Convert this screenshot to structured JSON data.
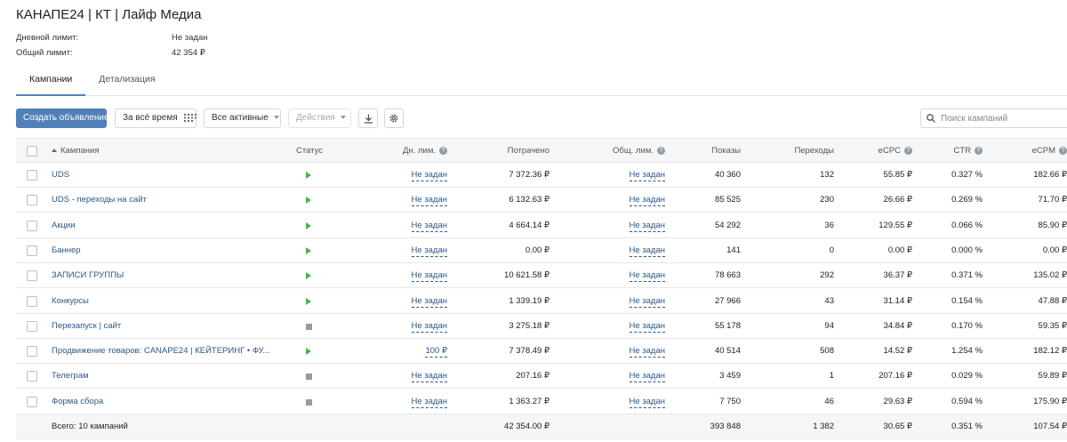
{
  "header": {
    "title": "КАНАПЕ24 | КТ | Лайф Медиа",
    "daily_limit_label": "Дневной лимит:",
    "daily_limit_value": "Не задан",
    "total_limit_label": "Общий лимит:",
    "total_limit_value": "42 354 ₽"
  },
  "tabs": [
    {
      "label": "Кампании",
      "active": true
    },
    {
      "label": "Детализация",
      "active": false
    }
  ],
  "toolbar": {
    "create_label": "Создать объявление",
    "period_label": "За всё время",
    "filter_label": "Все активные",
    "actions_label": "Действия",
    "search_placeholder": "Поиск кампаний",
    "download_icon": "download-icon",
    "settings_icon": "gear-icon"
  },
  "columns": {
    "campaign": "Кампания",
    "status": "Статус",
    "daily": "Дн. лим.",
    "spent": "Потрачено",
    "total": "Общ. лим.",
    "impressions": "Показы",
    "clicks": "Переходы",
    "ecpc": "eCPC",
    "ctr": "CTR",
    "ecpm": "eCPM"
  },
  "rows": [
    {
      "name": "UDS",
      "status": "play",
      "daily": "Не задан",
      "spent": "7 372.36 ₽",
      "total": "Не задан",
      "impressions": "40 360",
      "clicks": "132",
      "ecpc": "55.85 ₽",
      "ctr": "0.327 %",
      "ecpm": "182.66 ₽"
    },
    {
      "name": "UDS - переходы на сайт",
      "status": "play",
      "daily": "Не задан",
      "spent": "6 132.63 ₽",
      "total": "Не задан",
      "impressions": "85 525",
      "clicks": "230",
      "ecpc": "26.66 ₽",
      "ctr": "0.269 %",
      "ecpm": "71.70 ₽"
    },
    {
      "name": "Акции",
      "status": "play",
      "daily": "Не задан",
      "spent": "4 664.14 ₽",
      "total": "Не задан",
      "impressions": "54 292",
      "clicks": "36",
      "ecpc": "129.55 ₽",
      "ctr": "0.066 %",
      "ecpm": "85.90 ₽"
    },
    {
      "name": "Баннер",
      "status": "play",
      "daily": "Не задан",
      "spent": "0.00 ₽",
      "total": "Не задан",
      "impressions": "141",
      "clicks": "0",
      "ecpc": "0.00 ₽",
      "ctr": "0.000 %",
      "ecpm": "0.00 ₽"
    },
    {
      "name": "ЗАПИСИ ГРУППЫ",
      "status": "play",
      "daily": "Не задан",
      "spent": "10 621.58 ₽",
      "total": "Не задан",
      "impressions": "78 663",
      "clicks": "292",
      "ecpc": "36.37 ₽",
      "ctr": "0.371 %",
      "ecpm": "135.02 ₽"
    },
    {
      "name": "Конкурсы",
      "status": "play",
      "daily": "Не задан",
      "spent": "1 339.19 ₽",
      "total": "Не задан",
      "impressions": "27 966",
      "clicks": "43",
      "ecpc": "31.14 ₽",
      "ctr": "0.154 %",
      "ecpm": "47.88 ₽"
    },
    {
      "name": "Перезапуск | сайт",
      "status": "stop",
      "daily": "Не задан",
      "spent": "3 275.18 ₽",
      "total": "Не задан",
      "impressions": "55 178",
      "clicks": "94",
      "ecpc": "34.84 ₽",
      "ctr": "0.170 %",
      "ecpm": "59.35 ₽"
    },
    {
      "name": "Продвижение товаров: CANAPE24 | КЕЙТЕРИНГ • ФУ...",
      "status": "play",
      "daily": "100 ₽",
      "spent": "7 378.49 ₽",
      "total": "Не задан",
      "impressions": "40 514",
      "clicks": "508",
      "ecpc": "14.52 ₽",
      "ctr": "1.254 %",
      "ecpm": "182.12 ₽"
    },
    {
      "name": "Телеграм",
      "status": "stop",
      "daily": "Не задан",
      "spent": "207.16 ₽",
      "total": "Не задан",
      "impressions": "3 459",
      "clicks": "1",
      "ecpc": "207.16 ₽",
      "ctr": "0.029 %",
      "ecpm": "59.89 ₽"
    },
    {
      "name": "Форма сбора",
      "status": "stop",
      "daily": "Не задан",
      "spent": "1 363.27 ₽",
      "total": "Не задан",
      "impressions": "7 750",
      "clicks": "46",
      "ecpc": "29.63 ₽",
      "ctr": "0.594 %",
      "ecpm": "175.90 ₽"
    }
  ],
  "footer": {
    "label": "Всего: 10 кампаний",
    "spent": "42 354.00 ₽",
    "impressions": "393 848",
    "clicks": "1 382",
    "ecpc": "30.65 ₽",
    "ctr": "0.351 %",
    "ecpm": "107.54 ₽"
  },
  "colors": {
    "primary": "#5181b8",
    "link": "#2a5885",
    "active_status": "#4bb34b",
    "stopped_status": "#939ba5"
  }
}
